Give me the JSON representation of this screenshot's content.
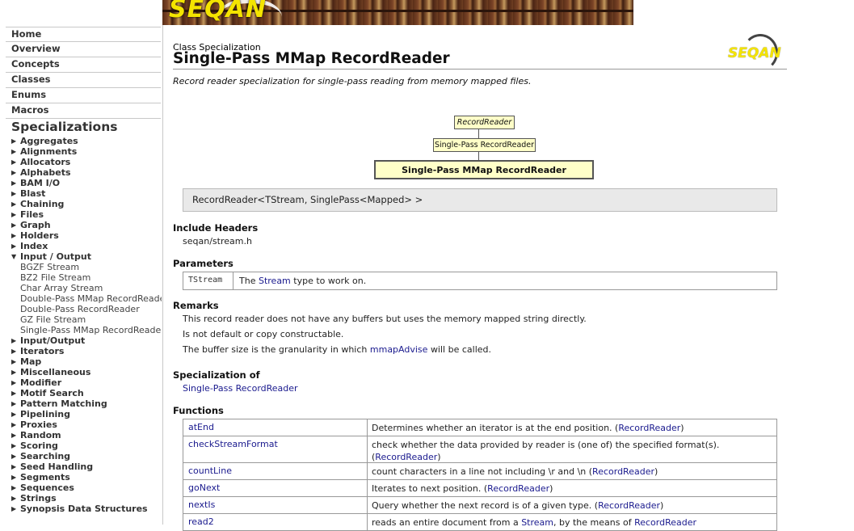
{
  "nav": {
    "links": [
      "Home",
      "Overview",
      "Concepts",
      "Classes",
      "Enums",
      "Macros"
    ],
    "section_title": "Specializations",
    "groups_before": [
      "Aggregates",
      "Alignments",
      "Allocators",
      "Alphabets",
      "BAM I/O",
      "Blast",
      "Chaining",
      "Files",
      "Graph",
      "Holders",
      "Index"
    ],
    "expanded_group": "Input / Output",
    "expanded_children": [
      "BGZF Stream",
      "BZ2 File Stream",
      "Char Array Stream",
      "Double-Pass MMap RecordReader",
      "Double-Pass RecordReader",
      "GZ File Stream",
      "Single-Pass MMap RecordReader"
    ],
    "groups_after": [
      "Input/Output",
      "Iterators",
      "Map",
      "Miscellaneous",
      "Modifier",
      "Motif Search",
      "Pattern Matching",
      "Pipelining",
      "Proxies",
      "Random",
      "Scoring",
      "Searching",
      "Seed Handling",
      "Segments",
      "Sequences",
      "Strings",
      "Synopsis Data Structures"
    ]
  },
  "banner": {
    "logo_text": "SEQAN"
  },
  "page": {
    "kind": "Class Specialization",
    "title": "Single-Pass MMap RecordReader",
    "logo_text": "SEQAN",
    "brief": "Record reader specialization for single-pass reading from memory mapped files."
  },
  "hierarchy": {
    "base": "RecordReader",
    "mid": "Single-Pass RecordReader",
    "current": "Single-Pass MMap RecordReader"
  },
  "signature": "RecordReader<TStream, SinglePass<Mapped> >",
  "include": {
    "heading": "Include Headers",
    "file": "seqan/stream.h"
  },
  "parameters": {
    "heading": "Parameters",
    "name": "TStream",
    "desc_pre": "The",
    "desc_link": "Stream",
    "desc_post": "type to work on."
  },
  "remarks": {
    "heading": "Remarks",
    "line1": "This record reader does not have any buffers but uses the memory mapped string directly.",
    "line2": "Is not default or copy constructable.",
    "line3_pre": "The buffer size is the granularity in which",
    "line3_link": "mmapAdvise",
    "line3_post": "will be called."
  },
  "specialization_of": {
    "heading": "Specialization of",
    "link": "Single-Pass RecordReader"
  },
  "functions": {
    "heading": "Functions",
    "rows": [
      {
        "name": "atEnd",
        "desc": "Determines whether an iterator is at the end position.",
        "ref": "RecordReader",
        "h": 21
      },
      {
        "name": "checkStreamFormat",
        "desc": "check whether the data provided by reader is (one of) the specified format(s).",
        "ref": "RecordReader",
        "h": 33
      },
      {
        "name": "countLine",
        "desc": "count characters in a line not including \\r and \\n",
        "ref": "RecordReader",
        "h": 21
      },
      {
        "name": "goNext",
        "desc": "Iterates to next position.",
        "ref": "RecordReader",
        "h": 21
      },
      {
        "name": "nextIs",
        "desc": "Query whether the next record is of a given type.",
        "ref": "RecordReader",
        "h": 21
      },
      {
        "name": "read2",
        "desc": "reads an entire document from a",
        "desc_link": "Stream",
        "desc_post": ", by the means of",
        "ref": "RecordReader",
        "h": 21
      }
    ]
  },
  "colors": {
    "link": "#1a1a8e",
    "yellow_box": "#ffffc8",
    "signature_bg": "#e9e9e9"
  }
}
